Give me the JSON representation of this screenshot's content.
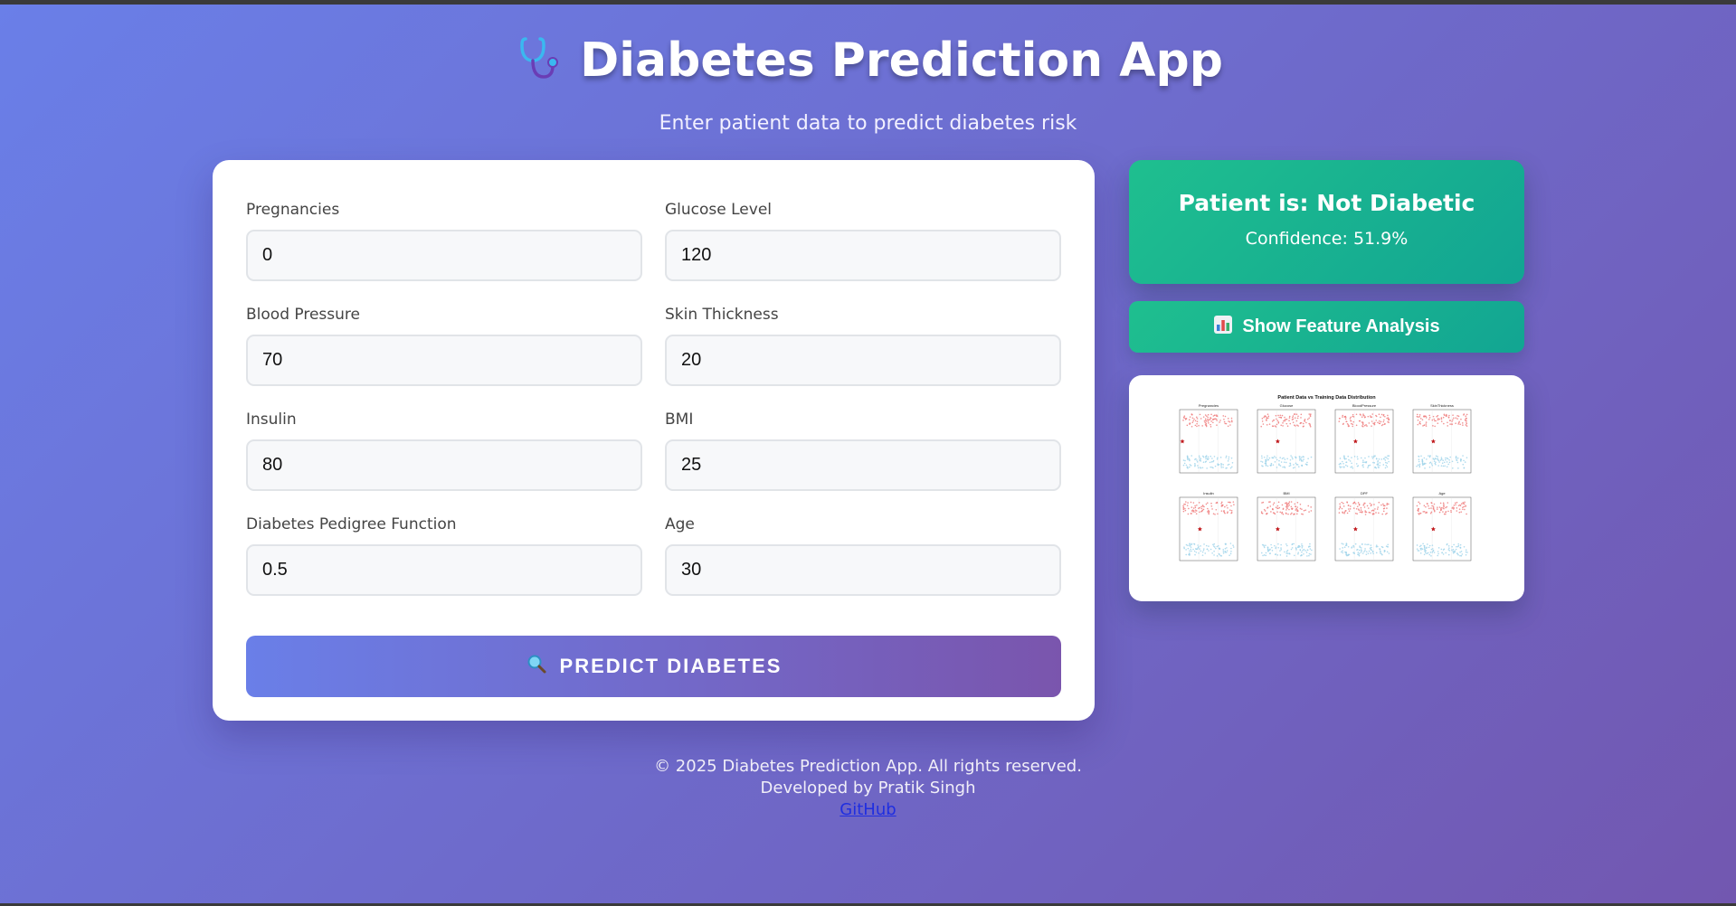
{
  "header": {
    "icon": "stethoscope-icon",
    "title": "Diabetes Prediction App",
    "subtitle": "Enter patient data to predict diabetes risk"
  },
  "form": {
    "fields": [
      {
        "label": "Pregnancies",
        "value": "0"
      },
      {
        "label": "Glucose Level",
        "value": "120"
      },
      {
        "label": "Blood Pressure",
        "value": "70"
      },
      {
        "label": "Skin Thickness",
        "value": "20"
      },
      {
        "label": "Insulin",
        "value": "80"
      },
      {
        "label": "BMI",
        "value": "25"
      },
      {
        "label": "Diabetes Pedigree Function",
        "value": "0.5"
      },
      {
        "label": "Age",
        "value": "30"
      }
    ],
    "predict_label": "PREDICT DIABETES",
    "predict_icon": "magnifier-icon"
  },
  "result": {
    "title": "Patient is: Not Diabetic",
    "confidence": "Confidence: 51.9%"
  },
  "analysis": {
    "button_label": "Show Feature Analysis",
    "button_icon": "bar-chart-icon"
  },
  "plot": {
    "title": "Patient Data vs Training Data Distribution",
    "panels": [
      "Pregnancies",
      "Glucose",
      "BloodPressure",
      "SkinThickness",
      "Insulin",
      "BMI",
      "DPF",
      "Age"
    ]
  },
  "footer": {
    "copyright": "© 2025 Diabetes Prediction App. All rights reserved.",
    "developer": "Developed by Pratik Singh",
    "link": "GitHub"
  },
  "colors": {
    "bg_start": "#6a7fe8",
    "bg_end": "#7257b0",
    "success": "#1fbf8f",
    "diabetic_dots": "#ef7b7b",
    "nondiabetic_dots": "#9fd3ea",
    "patient_star": "#c0171b"
  }
}
